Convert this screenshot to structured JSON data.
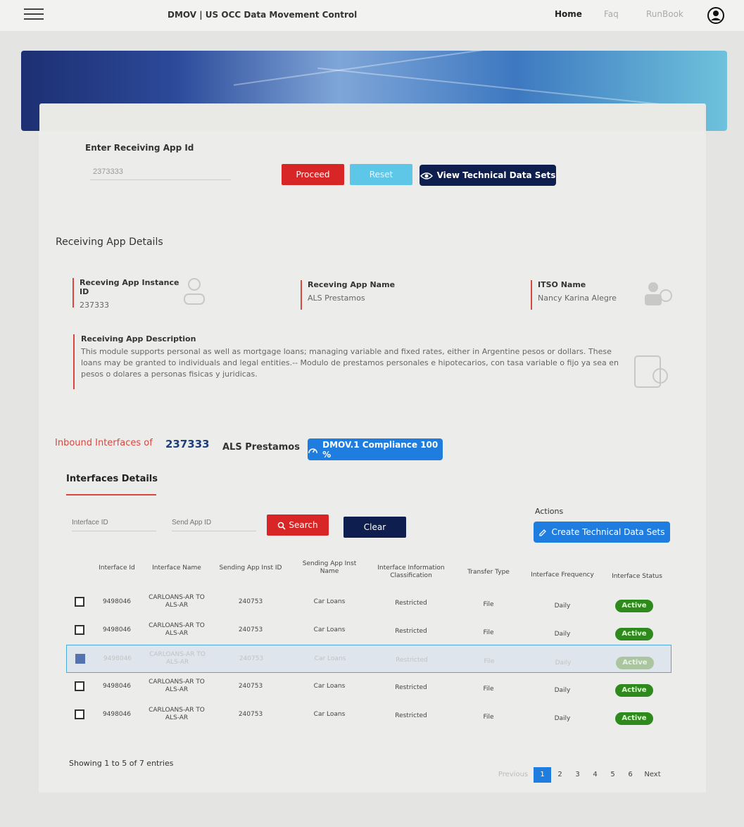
{
  "header": {
    "title": "DMOV | US OCC Data Movement Control",
    "nav": [
      "Home",
      "Faq",
      "RunBook"
    ]
  },
  "form": {
    "enter_label": "Enter Receiving App Id",
    "app_id_value": "2373333",
    "proceed": "Proceed",
    "reset": "Reset",
    "view_tech": "View Technical Data Sets"
  },
  "details": {
    "title": "Receiving App Details",
    "instance_label": "Receving App Instance ID",
    "instance_value": "237333",
    "name_label": "Receving App Name",
    "name_value": "ALS Prestamos",
    "itso_label": "ITSO Name",
    "itso_value": "Nancy Karina Alegre",
    "desc_label": "Receiving App Description",
    "desc_value": "This module supports personal as well as mortgage loans; managing variable and fixed rates, either in Argentine pesos or dollars. These loans may be granted to individuals and legal entities.-- Modulo de prestamos personales e hipotecarios, con tasa variable o fijo ya sea en pesos o dolares a personas fisicas y juridicas."
  },
  "inbound": {
    "label": "Inbound Interfaces of",
    "id": "237333",
    "name": "ALS Prestamos",
    "compliance": "DMOV.1 Compliance 100 %"
  },
  "interfaces": {
    "tab": "Interfaces Details",
    "interface_id_placeholder": "Interface ID",
    "send_app_placeholder": "Send App ID",
    "search": "Search",
    "clear": "Clear",
    "actions_label": "Actions",
    "create": "Create Technical Data Sets",
    "columns": [
      "Interface Id",
      "Interface Name",
      "Sending App Inst ID",
      "Sending App Inst Name",
      "Interface Information Classification",
      "Transfer Type",
      "Interface Frequency",
      "Interface Status"
    ],
    "rows": [
      {
        "id": "9498046",
        "name": "CARLOANS-AR TO ALS-AR",
        "send_id": "240753",
        "send_name": "Car Loans",
        "class": "Restricted",
        "type": "File",
        "freq": "Daily",
        "status": "Active"
      },
      {
        "id": "9498046",
        "name": "CARLOANS-AR TO ALS-AR",
        "send_id": "240753",
        "send_name": "Car Loans",
        "class": "Restricted",
        "type": "File",
        "freq": "Daily",
        "status": "Active"
      },
      {
        "id": "9498046",
        "name": "CARLOANS-AR TO ALS-AR",
        "send_id": "240753",
        "send_name": "Car Loans",
        "class": "Restricted",
        "type": "File",
        "freq": "Daily",
        "status": "Active"
      },
      {
        "id": "9498046",
        "name": "CARLOANS-AR TO ALS-AR",
        "send_id": "240753",
        "send_name": "Car Loans",
        "class": "Restricted",
        "type": "File",
        "freq": "Daily",
        "status": "Active"
      },
      {
        "id": "9498046",
        "name": "CARLOANS-AR TO ALS-AR",
        "send_id": "240753",
        "send_name": "Car Loans",
        "class": "Restricted",
        "type": "File",
        "freq": "Daily",
        "status": "Active"
      }
    ],
    "showing": "Showing 1 to 5 of 7 entries",
    "pager": [
      "Previous",
      "1",
      "2",
      "3",
      "4",
      "5",
      "6",
      "Next"
    ]
  },
  "colors": {
    "red": "#d82626",
    "navy": "#0e1e4e",
    "blue": "#1f7de0",
    "green": "#2f8a1e"
  }
}
